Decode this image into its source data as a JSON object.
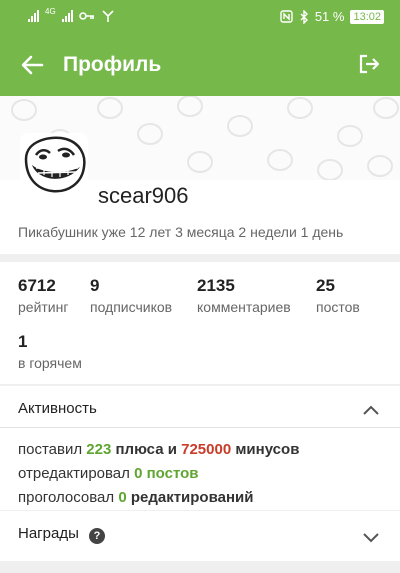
{
  "status_bar": {
    "lte_label": "4G",
    "battery": "51 %",
    "time": "13:02"
  },
  "app_bar": {
    "title": "Профиль"
  },
  "profile": {
    "nickname": "scear906",
    "member_since": "Пикабушник уже 12 лет 3 месяца 2 недели 1 день"
  },
  "stats": [
    {
      "value": "6712",
      "label": "рейтинг"
    },
    {
      "value": "9",
      "label": "подписчиков"
    },
    {
      "value": "2135",
      "label": "комментариев"
    },
    {
      "value": "25",
      "label": "постов"
    },
    {
      "value": "1",
      "label": "в горячем"
    }
  ],
  "activity": {
    "title": "Активность",
    "line1": {
      "pre": "поставил ",
      "plus_count": "223",
      "mid": " плюса и ",
      "minus_count": "725000",
      "post": " минусов"
    },
    "line2": {
      "pre": "отредактировал ",
      "count": "0 постов"
    },
    "line3": {
      "pre": "проголосовал ",
      "count": "0",
      "post": " редактирований"
    }
  },
  "awards": {
    "title": "Награды",
    "help": "?"
  },
  "colors": {
    "accent": "#76b84a",
    "positive": "#5fa531",
    "negative": "#c83c2a"
  }
}
